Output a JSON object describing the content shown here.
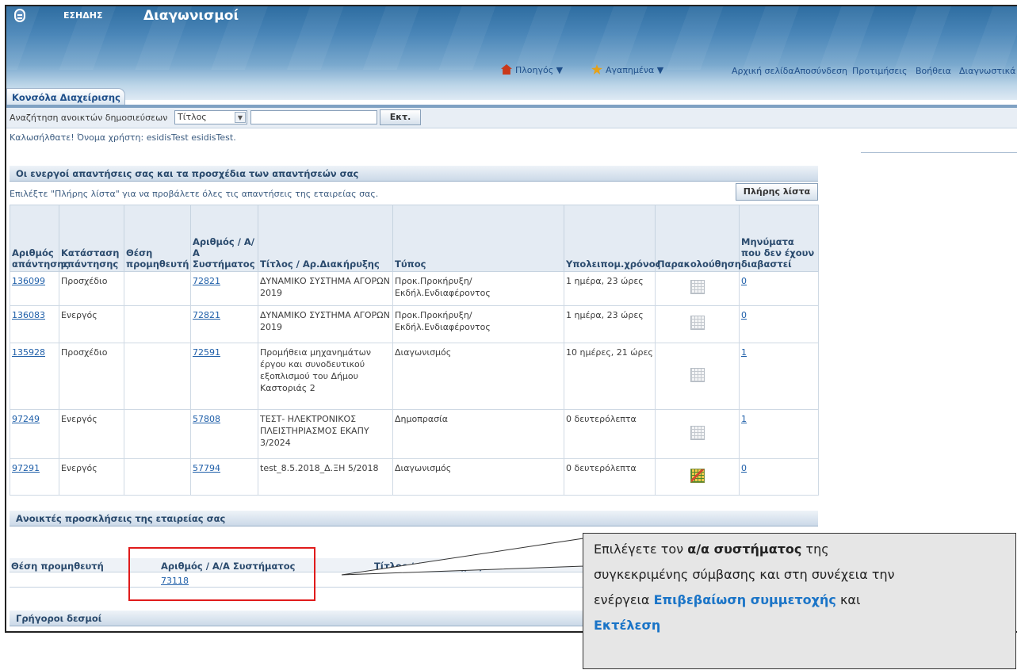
{
  "header": {
    "org": "ΕΣΗΔΗΣ",
    "app_title": "Διαγωνισμοί",
    "navigator": "Πλοηγός",
    "favorites": "Αγαπημένα",
    "links": [
      "Αρχική σελίδα",
      "Αποσύνδεση",
      "Προτιμήσεις",
      "Βοήθεια",
      "Διαγνωστικά"
    ]
  },
  "tab": {
    "label": "Κονσόλα Διαχείρισης"
  },
  "search": {
    "label": "Αναζήτηση ανοικτών δημοσιεύσεων",
    "select_value": "Τίτλος",
    "input_value": "",
    "go_label": "Εκτ."
  },
  "welcome": "Καλωσήλθατε! Όνομα χρήστη: esidisTest esidisTest.",
  "responses": {
    "section_title": "Οι ενεργοί απαντήσεις σας και τα προσχέδια των απαντήσεών σας",
    "hint": "Επιλέξτε \"Πλήρης λίστα\" για να προβάλετε όλες τις απαντήσεις της εταιρείας σας.",
    "full_list_label": "Πλήρης λίστα",
    "columns": [
      "Αριθμός απάντησης",
      "Κατάσταση απάντησης",
      "Θέση προμηθευτή",
      "Αριθμός / Α/Α Συστήματος",
      "Τίτλος / Αρ.Διακήρυξης",
      "Τύπος",
      "Υπολειπομ.χρόνος",
      "Παρακολούθηση",
      "Μηνύματα που δεν έχουν διαβαστεί"
    ],
    "rows": [
      {
        "number": "136099",
        "status": "Προσχέδιο",
        "position": "",
        "system_no": "72821",
        "title": "ΔΥΝΑΜΙΚΟ ΣΥΣΤΗΜΑ ΑΓΟΡΩΝ 2019",
        "type": "Προκ.Προκήρυξη/Εκδήλ.Ενδιαφέροντος",
        "remaining": "1 ημέρα, 23 ώρες",
        "monitor_icon": "grid-chart-icon",
        "unread": "0"
      },
      {
        "number": "136083",
        "status": "Ενεργός",
        "position": "",
        "system_no": "72821",
        "title": "ΔΥΝΑΜΙΚΟ ΣΥΣΤΗΜΑ ΑΓΟΡΩΝ 2019",
        "type": "Προκ.Προκήρυξη/Εκδήλ.Ενδιαφέροντος",
        "remaining": "1 ημέρα, 23 ώρες",
        "monitor_icon": "grid-chart-icon",
        "unread": "0"
      },
      {
        "number": "135928",
        "status": "Προσχέδιο",
        "position": "",
        "system_no": "72591",
        "title": "Προμήθεια μηχανημάτων έργου και συνοδευτικού εξοπλισμού του Δήμου Καστοριάς 2",
        "type": "Διαγωνισμός",
        "remaining": "10 ημέρες, 21 ώρες",
        "monitor_icon": "grid-chart-icon",
        "unread": "1"
      },
      {
        "number": "97249",
        "status": "Ενεργός",
        "position": "",
        "system_no": "57808",
        "title": "ΤΕΣΤ- ΗΛΕΚΤΡΟΝΙΚΟΣ ΠΛΕΙΣΤΗΡΙΑΣΜΟΣ ΕΚΑΠΥ 3/2024",
        "type": "Δημοπρασία",
        "remaining": "0 δευτερόλεπτα",
        "monitor_icon": "grid-chart-icon",
        "unread": "1"
      },
      {
        "number": "97291",
        "status": "Ενεργός",
        "position": "",
        "system_no": "57794",
        "title": "test_8.5.2018_Δ.ΞΗ 5/2018",
        "type": "Διαγωνισμός",
        "remaining": "0 δευτερόλεπτα",
        "monitor_icon": "active-chart-icon",
        "unread": "0"
      }
    ]
  },
  "invitations": {
    "section_title": "Ανοικτές προσκλήσεις της εταιρείας σας",
    "columns": [
      "Θέση προμηθευτή",
      "Αριθμός / Α/Α Συστήματος",
      "Τίτλος / Αρ.Διακήρυξ"
    ],
    "row": {
      "position": "",
      "system_no": "73118"
    }
  },
  "quick_links": {
    "section_title": "Γρήγοροι δεσμοί"
  },
  "callout": {
    "p1": "Επιλέγετε τον ",
    "p1_bold": "α/α συστήματος",
    "p1_end": " της",
    "p2": "συγκεκριμένης σύμβασης και στη συνέχεια την",
    "p3": "ενέργεια ",
    "p3_blue": "Επιβεβαίωση συμμετοχής",
    "p3_end": " και",
    "p4_blue": "Εκτέλεση"
  }
}
